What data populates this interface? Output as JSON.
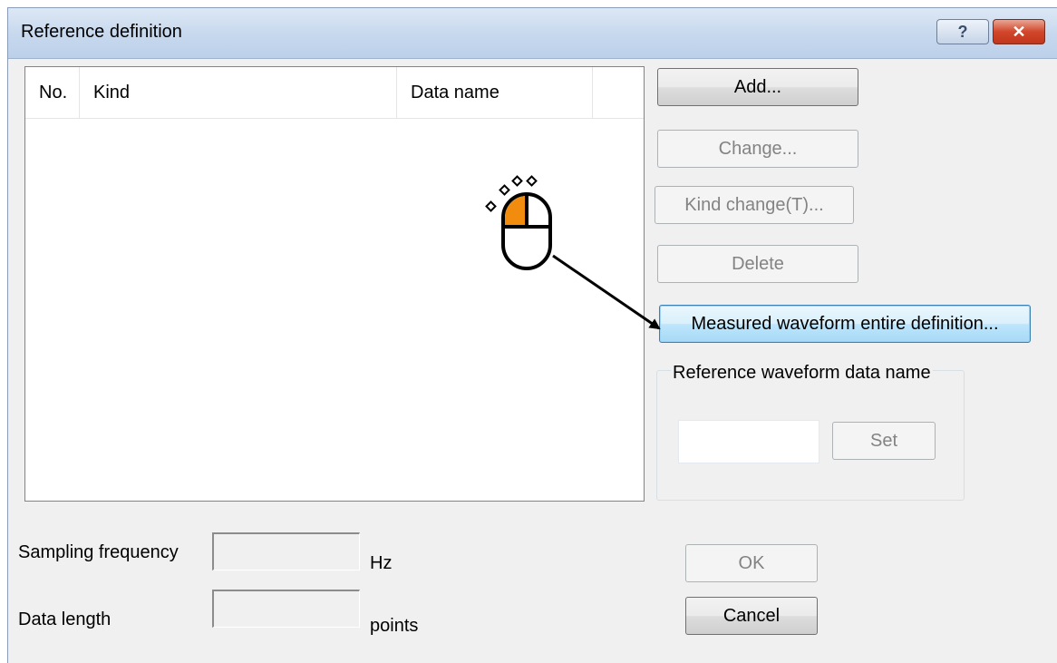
{
  "dialog": {
    "title": "Reference definition",
    "help_glyph": "?",
    "close_glyph": "✕"
  },
  "list": {
    "columns": [
      "No.",
      "Kind",
      "Data name",
      ""
    ]
  },
  "buttons": {
    "add": "Add...",
    "change": "Change...",
    "kind_change": "Kind change(T)...",
    "delete": "Delete",
    "measured": "Measured waveform entire definition...",
    "set": "Set",
    "ok": "OK",
    "cancel": "Cancel"
  },
  "group": {
    "label": "Reference waveform data name",
    "input_value": ""
  },
  "fields": {
    "sampling_label": "Sampling frequency",
    "sampling_value": "",
    "sampling_unit": "Hz",
    "datalen_label": "Data length",
    "datalen_value": "",
    "datalen_unit": "points"
  },
  "colors": {
    "mouse_accent": "#f28c0f",
    "focus_border": "#3c7fb1"
  },
  "annotation": {
    "icon": "mouse-left-click-icon"
  }
}
